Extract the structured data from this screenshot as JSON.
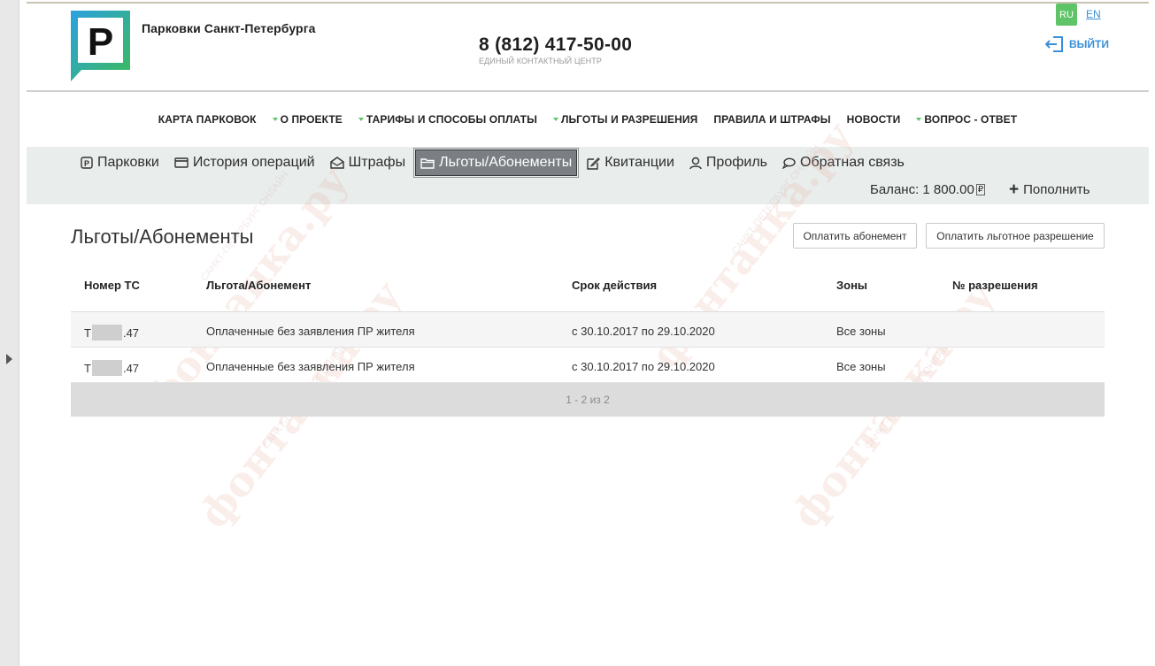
{
  "header": {
    "site_title": "Парковки Санкт-Петербурга",
    "phone": "8 (812) 417-50-00",
    "phone_caption": "ЕДИНЫЙ КОНТАКТНЫЙ ЦЕНТР",
    "lang_ru": "RU",
    "lang_en": "EN",
    "logout": "ВЫЙТИ"
  },
  "nav": {
    "items": [
      {
        "label": "КАРТА ПАРКОВОК",
        "dropdown": false
      },
      {
        "label": "О ПРОЕКТЕ",
        "dropdown": true
      },
      {
        "label": "ТАРИФЫ И СПОСОБЫ ОПЛАТЫ",
        "dropdown": true
      },
      {
        "label": "ЛЬГОТЫ И РАЗРЕШЕНИЯ",
        "dropdown": true
      },
      {
        "label": "ПРАВИЛА И ШТРАФЫ",
        "dropdown": false
      },
      {
        "label": "НОВОСТИ",
        "dropdown": false
      },
      {
        "label": "ВОПРОС - ОТВЕТ",
        "dropdown": true
      }
    ]
  },
  "account_nav": {
    "tabs": [
      {
        "label": "Парковки",
        "icon": "parking-icon"
      },
      {
        "label": "История операций",
        "icon": "card-icon"
      },
      {
        "label": "Штрафы",
        "icon": "envelope-icon"
      },
      {
        "label": "Льготы/Абонементы",
        "icon": "folder-icon"
      },
      {
        "label": "Квитанции",
        "icon": "edit-icon"
      },
      {
        "label": "Профиль",
        "icon": "user-icon"
      },
      {
        "label": "Обратная связь",
        "icon": "chat-icon"
      }
    ],
    "balance_label": "Баланс: 1 800.00",
    "currency": "₽",
    "topup": "Пополнить"
  },
  "page": {
    "title": "Льготы/Абонементы",
    "btn_subscription": "Оплатить абонемент",
    "btn_permit": "Оплатить льготное разрешение"
  },
  "table": {
    "headers": {
      "plate": "Номер ТС",
      "benefit": "Льгота/Абонемент",
      "validity": "Срок действия",
      "zones": "Зоны",
      "permit_no": "№ разрешения"
    },
    "rows": [
      {
        "plate_prefix": "Т",
        "plate_suffix": "47",
        "benefit": "Оплаченные без заявления ПР жителя",
        "validity": "с 30.10.2017 по 29.10.2020",
        "zones": "Все зоны",
        "permit_no": ""
      },
      {
        "plate_prefix": "Т",
        "plate_suffix": "47",
        "benefit": "Оплаченные без заявления ПР жителя",
        "validity": "с 30.10.2017 по 29.10.2020",
        "zones": "Все зоны",
        "permit_no": ""
      }
    ],
    "pagination": "1 - 2 из 2"
  },
  "watermark": {
    "text": "фонтанка.ру",
    "subtext": "САНКТ-ПЕТЕРБУРГ ОНЛАЙН"
  },
  "colors": {
    "accent_green": "#5ec467",
    "link_blue": "#3a8fd8",
    "subnav_bg": "#e9edec",
    "active_tab": "#7b7f83"
  }
}
